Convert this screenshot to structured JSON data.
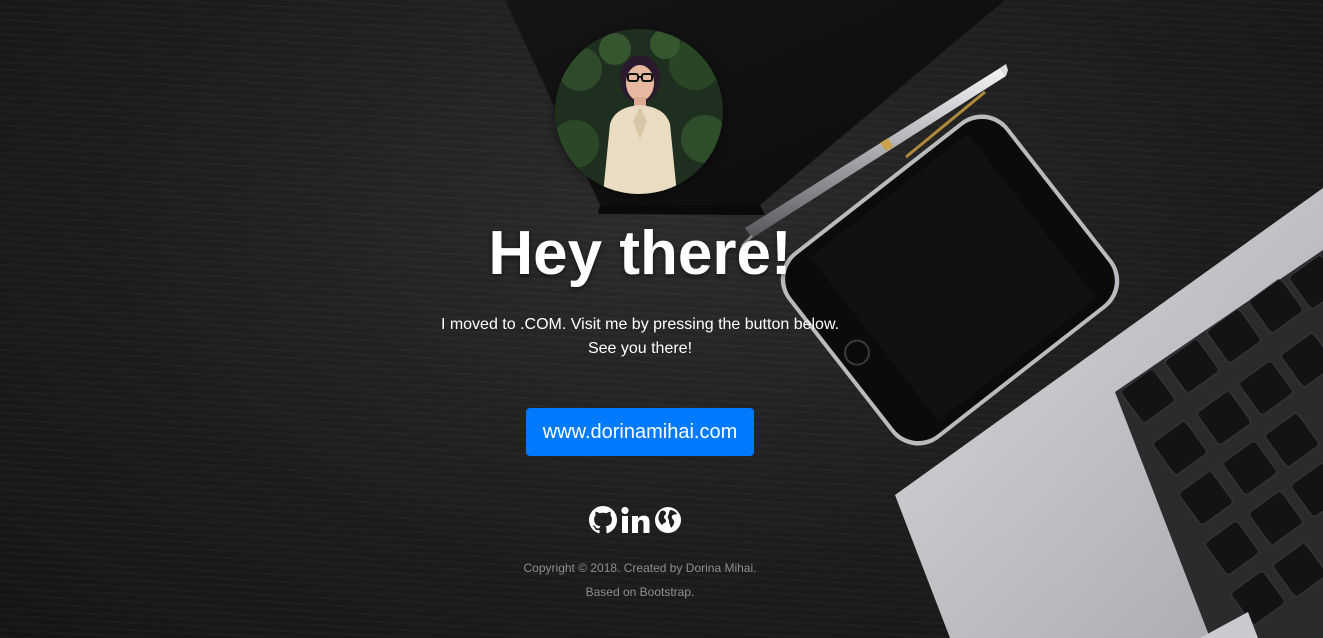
{
  "hero": {
    "avatar_alt": "Dorina Mihai",
    "heading": "Hey there!",
    "message_line1": "I moved to .COM. Visit me by pressing the button below.",
    "message_line2": "See you there!",
    "button_label": "www.dorinamihai.com"
  },
  "social": {
    "links": [
      {
        "icon": "github-icon"
      },
      {
        "icon": "linkedin-icon"
      },
      {
        "icon": "globe-icon"
      }
    ]
  },
  "footer": {
    "copyright": "Copyright © 2018. Created by Dorina Mihai.",
    "based_on": "Based on Bootstrap."
  },
  "colors": {
    "accent": "#007bff",
    "background": "#1e1e1e",
    "text": "#ffffff",
    "footer_text": "#8b8e93"
  }
}
